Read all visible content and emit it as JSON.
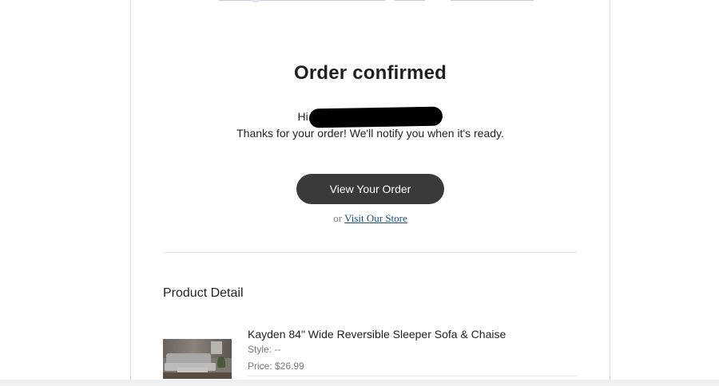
{
  "email": {
    "title": "Order confirmed",
    "greeting_prefix": "Hi",
    "thanks_message": "Thanks for your order! We'll notify you when it's ready.",
    "view_order_button": "View Your Order",
    "or_text": "or",
    "store_link": "Visit Our Store"
  },
  "product_detail": {
    "section_title": "Product Detail",
    "items": [
      {
        "name": "Kayden 84\" Wide Reversible Sleeper Sofa & Chaise",
        "style": "Style: --",
        "price": "Price: $26.99"
      }
    ]
  },
  "colors": {
    "button_bg": "#3a3a3a",
    "link": "#1a4a7a",
    "redaction": "#000000"
  }
}
